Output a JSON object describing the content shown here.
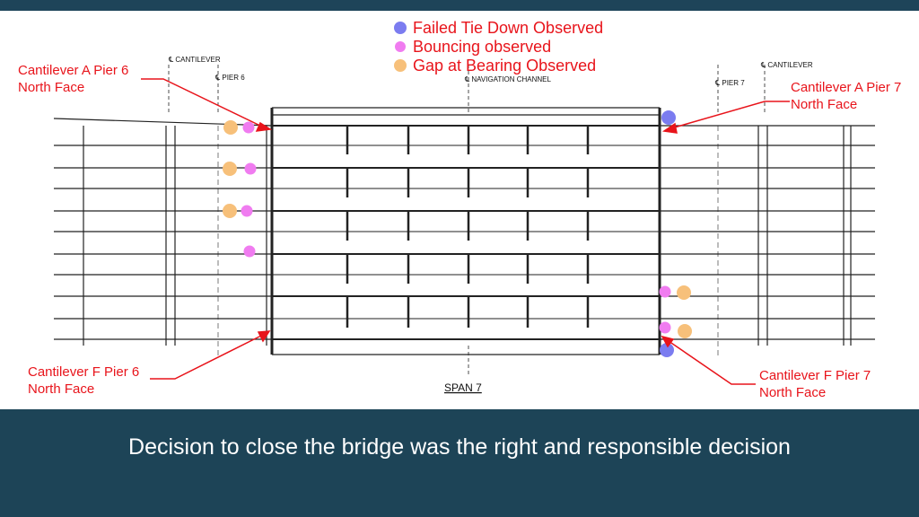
{
  "legend": [
    {
      "label": "Failed Tie Down Observed",
      "color": "#7b7cf0"
    },
    {
      "label": "Bouncing observed",
      "color": "#f07cf0"
    },
    {
      "label": "Gap at Bearing Observed",
      "color": "#f7c07a"
    }
  ],
  "drawing_labels": {
    "cantilever_left": "℄ CANTILEVER",
    "pier6": "℄ PIER 6",
    "nav_channel": "℄ NAVIGATION CHANNEL",
    "pier7": "℄ PIER 7",
    "cantilever_right": "℄ CANTILEVER",
    "span": "SPAN 7"
  },
  "callouts": {
    "a6_line1": "Cantilever A Pier 6",
    "a6_line2": "North Face",
    "a7_line1": "Cantilever A Pier 7",
    "a7_line2": "North Face",
    "f6_line1": "Cantilever F Pier 6",
    "f6_line2": "North Face",
    "f7_line1": "Cantilever F Pier 7",
    "f7_line2": "North Face"
  },
  "caption": "Decision to close the bridge was the right and responsible decision",
  "colors": {
    "accent_red": "#e8141b",
    "band": "#1d4457"
  }
}
